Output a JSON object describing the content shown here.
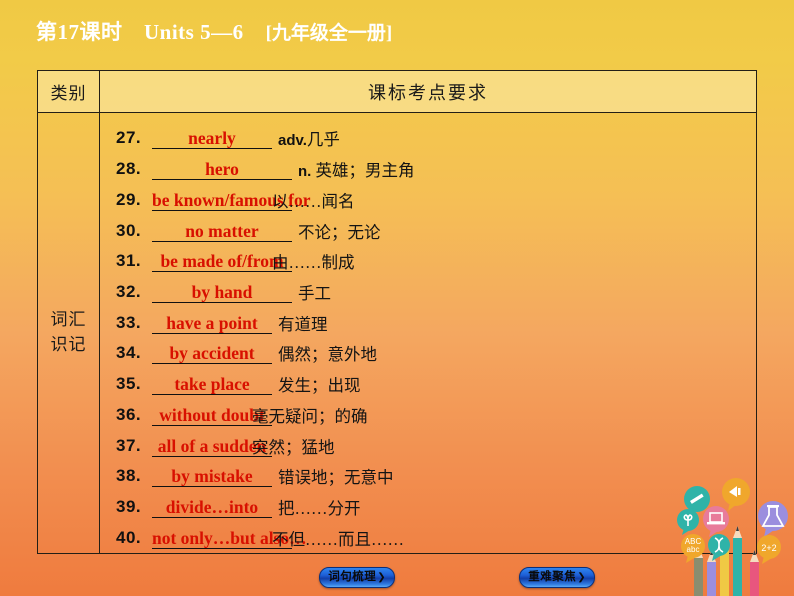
{
  "slide": {
    "title_main": "第17课时　Units 5—6",
    "title_sub": "[九年级全一册]",
    "bg_top_color": "#f0c944",
    "bg_bottom_color": "#ef7b3e",
    "answer_color": "#d81000"
  },
  "table": {
    "headers": {
      "category": "类别",
      "requirement": "课标考点要求"
    },
    "category_label": "词汇\n识记",
    "category_line1": "词汇",
    "category_line2": "识记",
    "rows": [
      {
        "num": "27.",
        "answer": "nearly",
        "pos": "adv.",
        "meaning": "几乎",
        "width": "w-narrow",
        "overflow": false
      },
      {
        "num": "28.",
        "answer": "hero",
        "pos": "n.",
        "meaning": " 英雄；男主角",
        "width": "w-mid",
        "overflow": false
      },
      {
        "num": "29.",
        "answer": "be known/famous for",
        "pos": "",
        "meaning": "以……闻名",
        "width": "w-mid",
        "overflow": true
      },
      {
        "num": "30.",
        "answer": "no matter",
        "pos": "",
        "meaning": "不论；无论",
        "width": "w-mid",
        "overflow": false
      },
      {
        "num": "31.",
        "answer": "be made of/from",
        "pos": "",
        "meaning": "由……制成",
        "width": "w-mid",
        "overflow": true
      },
      {
        "num": "32.",
        "answer": "by hand",
        "pos": "",
        "meaning": "手工",
        "width": "w-mid",
        "overflow": false
      },
      {
        "num": "33.",
        "answer": "have a point",
        "pos": "",
        "meaning": "有道理",
        "width": "w-narrow",
        "overflow": false
      },
      {
        "num": "34.",
        "answer": "by accident",
        "pos": "",
        "meaning": "偶然；意外地",
        "width": "w-narrow",
        "overflow": false
      },
      {
        "num": "35.",
        "answer": "take place",
        "pos": "",
        "meaning": "发生；出现",
        "width": "w-narrow",
        "overflow": false
      },
      {
        "num": "36.",
        "answer": "without doubt",
        "pos": "",
        "meaning": "毫无疑问；的确",
        "width": "w-narrow",
        "overflow": true
      },
      {
        "num": "37.",
        "answer": "all of a sudden",
        "pos": "",
        "meaning": "突然；猛地",
        "width": "w-narrow",
        "overflow": true
      },
      {
        "num": "38.",
        "answer": "by mistake",
        "pos": "",
        "meaning": "错误地；无意中",
        "width": "w-narrow",
        "overflow": false
      },
      {
        "num": "39.",
        "answer": "divide…into",
        "pos": "",
        "meaning": "把……分开",
        "width": "w-narrow",
        "overflow": false
      },
      {
        "num": "40.",
        "answer": "not only…but also…",
        "pos": "",
        "meaning": "不但……而且……",
        "width": "w-mid",
        "overflow": true
      }
    ]
  },
  "nav": {
    "buttons": [
      {
        "label": "词句梳理",
        "arrow": "❯"
      },
      {
        "label": "重难聚焦",
        "arrow": "❯"
      }
    ]
  },
  "decor": {
    "bubbles": [
      {
        "icon": "pencil-bubble-icon",
        "color": "#2fb3a8"
      },
      {
        "icon": "checkmark-bubble-icon",
        "color": "#f0a72c"
      },
      {
        "icon": "plant-bubble-icon",
        "color": "#2fb3a8"
      },
      {
        "icon": "laptop-bubble-icon",
        "color": "#e87b9a"
      },
      {
        "icon": "flask-bubble-icon",
        "color": "#9b8ede"
      },
      {
        "icon": "abc-bubble-icon",
        "color": "#f0a72c"
      },
      {
        "icon": "dna-bubble-icon",
        "color": "#2fb3a8"
      },
      {
        "icon": "math-bubble-icon",
        "color": "#f0a72c"
      }
    ],
    "pencils": [
      "#8a8d6f",
      "#9b8ede",
      "#f0c944",
      "#2fb3a8",
      "#e8567e"
    ]
  }
}
